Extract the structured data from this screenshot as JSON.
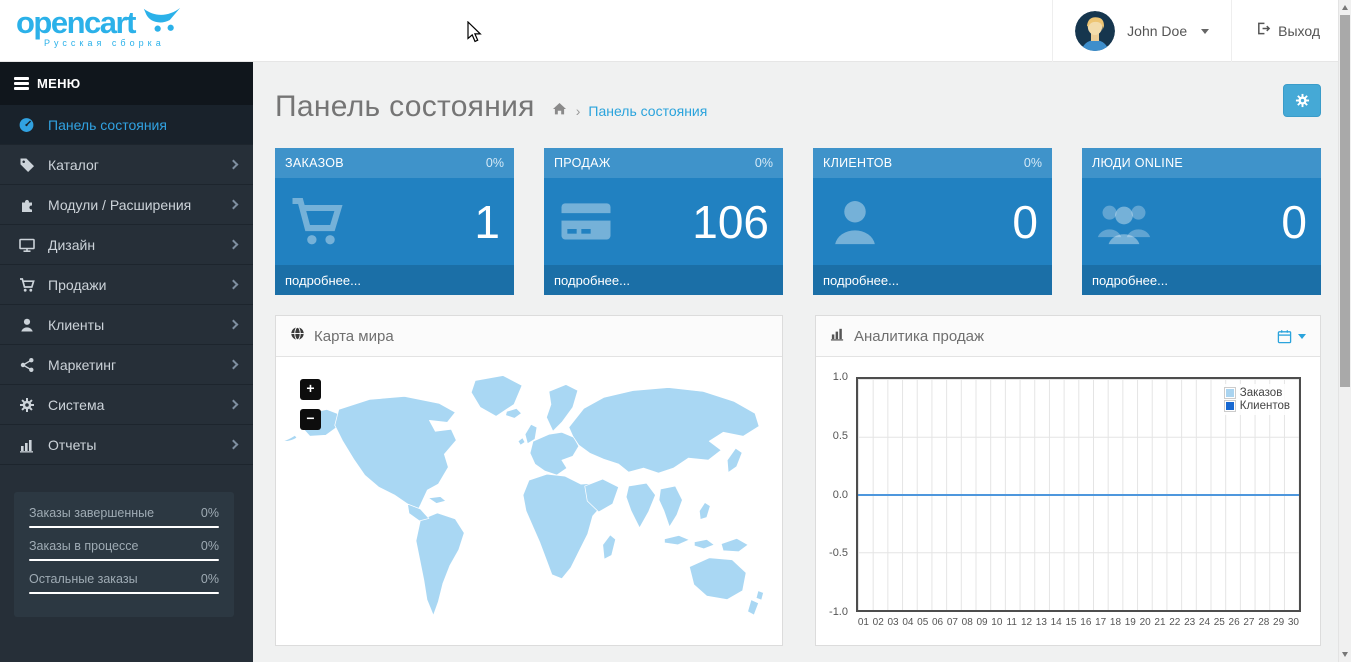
{
  "brand": {
    "name": "opencart",
    "subtitle": "Русская сборка",
    "color": "#2bb1e9"
  },
  "header": {
    "user_name": "John Doe",
    "logout_label": "Выход"
  },
  "sidebar": {
    "menu_label": "МЕНЮ",
    "items": [
      {
        "label": "Панель состояния",
        "icon": "dashboard-icon",
        "active": true,
        "has_children": false
      },
      {
        "label": "Каталог",
        "icon": "tag-icon",
        "active": false,
        "has_children": true
      },
      {
        "label": "Модули / Расширения",
        "icon": "puzzle-icon",
        "active": false,
        "has_children": true
      },
      {
        "label": "Дизайн",
        "icon": "display-icon",
        "active": false,
        "has_children": true
      },
      {
        "label": "Продажи",
        "icon": "cart-icon",
        "active": false,
        "has_children": true
      },
      {
        "label": "Клиенты",
        "icon": "user-icon",
        "active": false,
        "has_children": true
      },
      {
        "label": "Маркетинг",
        "icon": "share-icon",
        "active": false,
        "has_children": true
      },
      {
        "label": "Система",
        "icon": "gear-icon",
        "active": false,
        "has_children": true
      },
      {
        "label": "Отчеты",
        "icon": "bar-chart-icon",
        "active": false,
        "has_children": true
      }
    ],
    "stats": [
      {
        "label": "Заказы завершенные",
        "value": "0%"
      },
      {
        "label": "Заказы в процессе",
        "value": "0%"
      },
      {
        "label": "Остальные заказы",
        "value": "0%"
      }
    ]
  },
  "page": {
    "title": "Панель состояния",
    "breadcrumb_separator": "›",
    "breadcrumb": "Панель состояния"
  },
  "tiles": [
    {
      "title": "ЗАКАЗОВ",
      "percent": "0%",
      "value": "1",
      "link": "подробнее...",
      "icon": "cart-icon"
    },
    {
      "title": "ПРОДАЖ",
      "percent": "0%",
      "value": "106",
      "link": "подробнее...",
      "icon": "credit-card-icon"
    },
    {
      "title": "КЛИЕНТОВ",
      "percent": "0%",
      "value": "0",
      "link": "подробнее...",
      "icon": "user-icon"
    },
    {
      "title": "ЛЮДИ ONLINE",
      "percent": "",
      "value": "0",
      "link": "подробнее...",
      "icon": "users-icon"
    }
  ],
  "map_panel": {
    "title": "Карта мира",
    "zoom_in": "+",
    "zoom_out": "−"
  },
  "chart_panel": {
    "title": "Аналитика продаж"
  },
  "chart_data": {
    "type": "line",
    "title": "Аналитика продаж",
    "x": [
      "01",
      "02",
      "03",
      "04",
      "05",
      "06",
      "07",
      "08",
      "09",
      "10",
      "11",
      "12",
      "13",
      "14",
      "15",
      "16",
      "17",
      "18",
      "19",
      "20",
      "21",
      "22",
      "23",
      "24",
      "25",
      "26",
      "27",
      "28",
      "29",
      "30"
    ],
    "series": [
      {
        "name": "Заказов",
        "color": "#aad4f0",
        "values": [
          0,
          0,
          0,
          0,
          0,
          0,
          0,
          0,
          0,
          0,
          0,
          0,
          0,
          0,
          0,
          0,
          0,
          0,
          0,
          0,
          0,
          0,
          0,
          0,
          0,
          0,
          0,
          0,
          0,
          0
        ]
      },
      {
        "name": "Клиентов",
        "color": "#1768d1",
        "values": [
          0,
          0,
          0,
          0,
          0,
          0,
          0,
          0,
          0,
          0,
          0,
          0,
          0,
          0,
          0,
          0,
          0,
          0,
          0,
          0,
          0,
          0,
          0,
          0,
          0,
          0,
          0,
          0,
          0,
          0
        ]
      }
    ],
    "ylim": [
      -1.0,
      1.0
    ],
    "yticks": [
      "1.0",
      "0.5",
      "0.0",
      "-0.5",
      "-1.0"
    ],
    "xlabel": "",
    "ylabel": "",
    "grid": true,
    "legend_position": "top-right",
    "colors": {
      "zero_line": "#4e97dd",
      "plot_border": "#4d4d4d",
      "gridline": "#e4e4e4"
    }
  },
  "colors": {
    "accent_blue": "#2aa3dc",
    "tile_header": "#3f93ca",
    "tile_body": "#2181c1",
    "tile_footer": "#1b6fa7",
    "sidebar_bg": "#262f38",
    "map_fill": "#a9d7f3"
  }
}
